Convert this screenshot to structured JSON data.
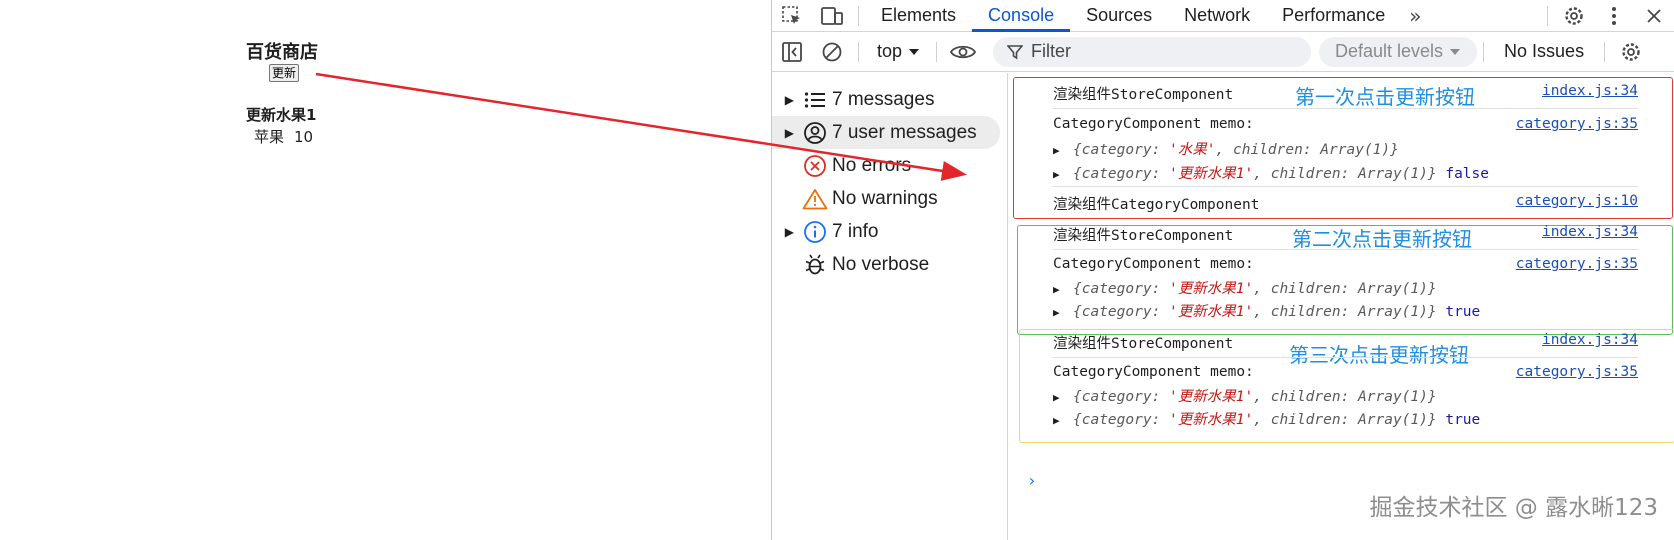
{
  "page": {
    "store_title": "百货商店",
    "update_button": "更新",
    "category_title": "更新水果1",
    "item_name": "苹果",
    "item_count": "10"
  },
  "devtools": {
    "tabs": [
      "Elements",
      "Console",
      "Sources",
      "Network",
      "Performance"
    ],
    "active_tab": "Console",
    "toolbar": {
      "context": "top",
      "filter_placeholder": "Filter",
      "levels": "Default levels",
      "issues": "No Issues"
    },
    "sidebar": [
      {
        "label": "7 messages",
        "icon": "list-icon",
        "expandable": true
      },
      {
        "label": "7 user messages",
        "icon": "user-icon",
        "expandable": true
      },
      {
        "label": "No errors",
        "icon": "error-icon",
        "expandable": false
      },
      {
        "label": "No warnings",
        "icon": "warning-icon",
        "expandable": false
      },
      {
        "label": "7 info",
        "icon": "info-icon",
        "expandable": true
      },
      {
        "label": "No verbose",
        "icon": "bug-icon",
        "expandable": false
      }
    ],
    "groups": [
      {
        "annotation": "第一次点击更新按钮",
        "color": "#e53935",
        "render_store": {
          "text": "渲染组件StoreComponent",
          "source": "index.js:34"
        },
        "memo": {
          "text": "CategoryComponent memo:",
          "source": "category.js:35"
        },
        "prev": {
          "key1": "category",
          "value": "'水果'",
          "key2": "children",
          "type": "Array(1)"
        },
        "next": {
          "key1": "category",
          "value": "'更新水果1'",
          "key2": "children",
          "type": "Array(1)",
          "result": "false"
        },
        "render_category": {
          "text": "渲染组件CategoryComponent",
          "source": "category.js:10"
        }
      },
      {
        "annotation": "第二次点击更新按钮",
        "color": "#5cbf5a",
        "render_store": {
          "text": "渲染组件StoreComponent",
          "source": "index.js:34"
        },
        "memo": {
          "text": "CategoryComponent memo:",
          "source": "category.js:35"
        },
        "prev": {
          "key1": "category",
          "value": "'更新水果1'",
          "key2": "children",
          "type": "Array(1)"
        },
        "next": {
          "key1": "category",
          "value": "'更新水果1'",
          "key2": "children",
          "type": "Array(1)",
          "result": "true"
        }
      },
      {
        "annotation": "第三次点击更新按钮",
        "color": "#f2d46a",
        "render_store": {
          "text": "渲染组件StoreComponent",
          "source": "index.js:34"
        },
        "memo": {
          "text": "CategoryComponent memo:",
          "source": "category.js:35"
        },
        "prev": {
          "key1": "category",
          "value": "'更新水果1'",
          "key2": "children",
          "type": "Array(1)"
        },
        "next": {
          "key1": "category",
          "value": "'更新水果1'",
          "key2": "children",
          "type": "Array(1)",
          "result": "true"
        }
      }
    ],
    "prompt": "›"
  },
  "watermark": "掘金技术社区 @ 露水晰123"
}
